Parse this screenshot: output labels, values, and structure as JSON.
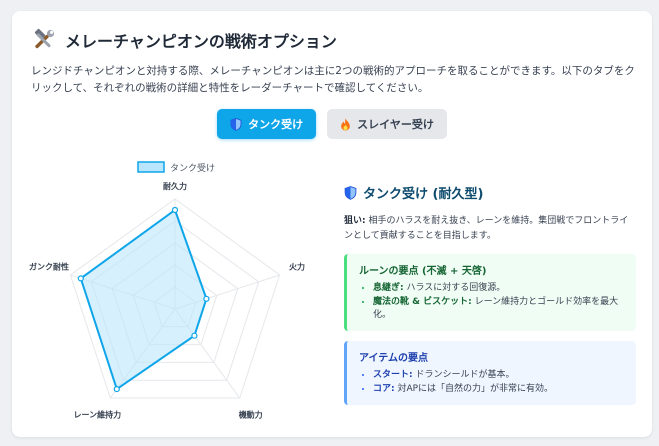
{
  "header": {
    "title": "メレーチャンピオンの戦術オプション",
    "icon": "hammer-wrench-icon",
    "intro": "レンジドチャンピオンと対持する際、メレーチャンピオンは主に2つの戦術的アプローチを取ることができます。以下のタブをクリックして、それぞれの戦術の詳細と特性をレーダーチャートで確認してください。"
  },
  "tabs": [
    {
      "label": "タンク受け",
      "icon": "shield-icon",
      "active": true
    },
    {
      "label": "スレイヤー受け",
      "icon": "flame-icon",
      "active": false
    }
  ],
  "chart_data": {
    "type": "radar",
    "axes": [
      "耐久力",
      "火力",
      "機動力",
      "レーン維持力",
      "ガンク耐性"
    ],
    "series": [
      {
        "name": "タンク受け",
        "values": [
          9,
          3,
          3,
          9,
          9
        ]
      }
    ],
    "range": [
      0,
      10
    ],
    "grid_levels": 5,
    "legend_position": "top",
    "fill_color": "#bae6fd",
    "stroke_color": "#0ea5e9"
  },
  "detail": {
    "icon": "shield-icon",
    "title": "タンク受け (耐久型)",
    "aim_label": "狙い:",
    "aim_text": " 相手のハラスを耐え抜き、レーンを維持。集団戦でフロントラインとして貢献することを目指します。",
    "rune_box": {
      "title": "ルーンの要点 (不滅 + 天啓)",
      "items": [
        {
          "label": "息継ぎ:",
          "text": " ハラスに対する回復源。"
        },
        {
          "label": "魔法の靴 & ビスケット:",
          "text": " レーン維持力とゴールド効率を最大化。"
        }
      ]
    },
    "item_box": {
      "title": "アイテムの要点",
      "items": [
        {
          "label": "スタート:",
          "text": " ドランシールドが基本。"
        },
        {
          "label": "コア:",
          "text": " 対APには「自然の力」が非常に有効。"
        }
      ]
    }
  }
}
